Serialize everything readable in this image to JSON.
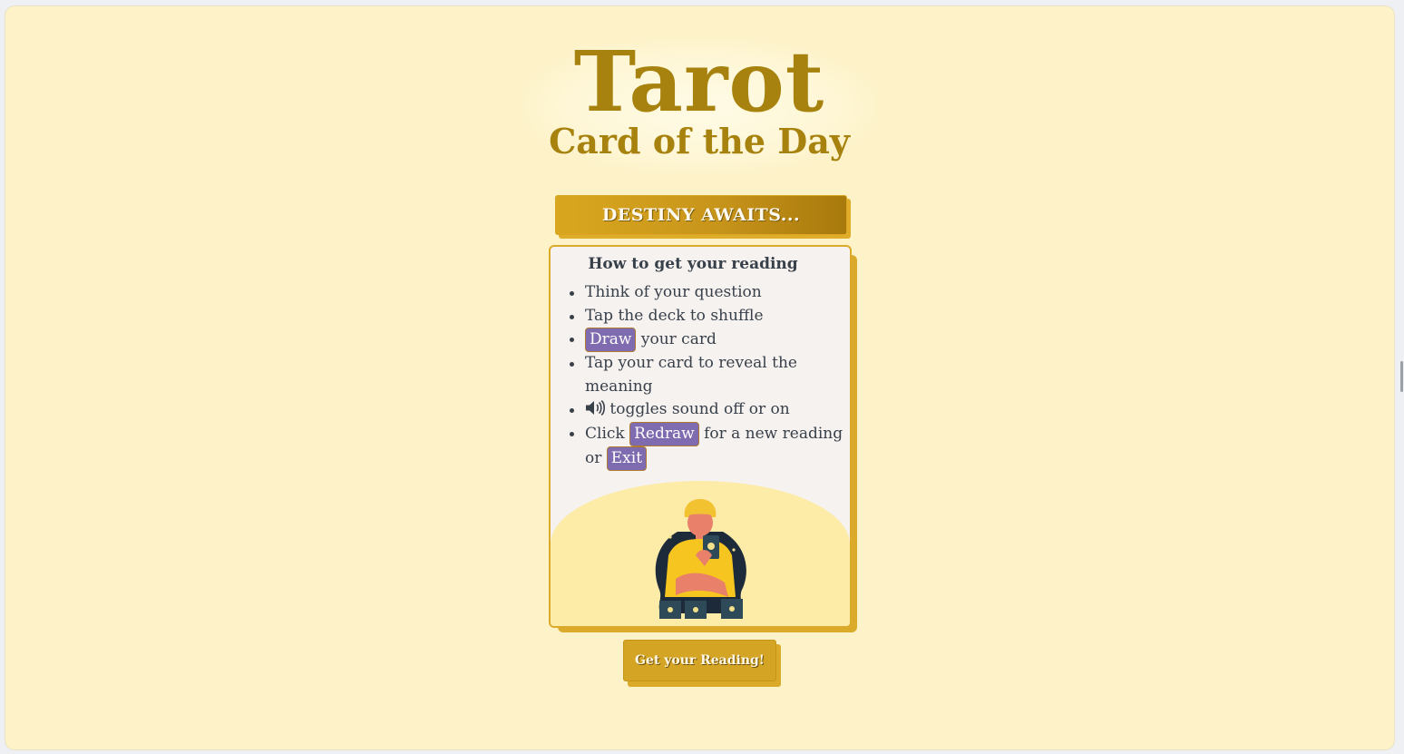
{
  "header": {
    "title": "Tarot",
    "subtitle": "Card of the Day"
  },
  "banner": {
    "text": "DESTINY AWAITS..."
  },
  "instructions": {
    "title": "How to get your reading",
    "step1": "Think of your question",
    "step2": "Tap the deck to shuffle",
    "step3_button": "Draw",
    "step3_text": " your card",
    "step4": "Tap your card to reveal the meaning",
    "step5_text": " toggles sound off or on",
    "step6_prefix": "Click ",
    "step6_button": "Redraw",
    "step6_middle": " for a new reading or ",
    "step6_exit": "Exit"
  },
  "cta": {
    "label": "Get your Reading!"
  },
  "colors": {
    "background": "#fdf2c8",
    "gold": "#d4a424",
    "gold_dark": "#a8820e",
    "pill_purple": "#7f6cb0",
    "card_bg": "#f6f2f0",
    "text": "#38404a"
  },
  "icons": {
    "speaker": "speaker-volume-icon",
    "illustration": "fortune-teller-illustration"
  }
}
